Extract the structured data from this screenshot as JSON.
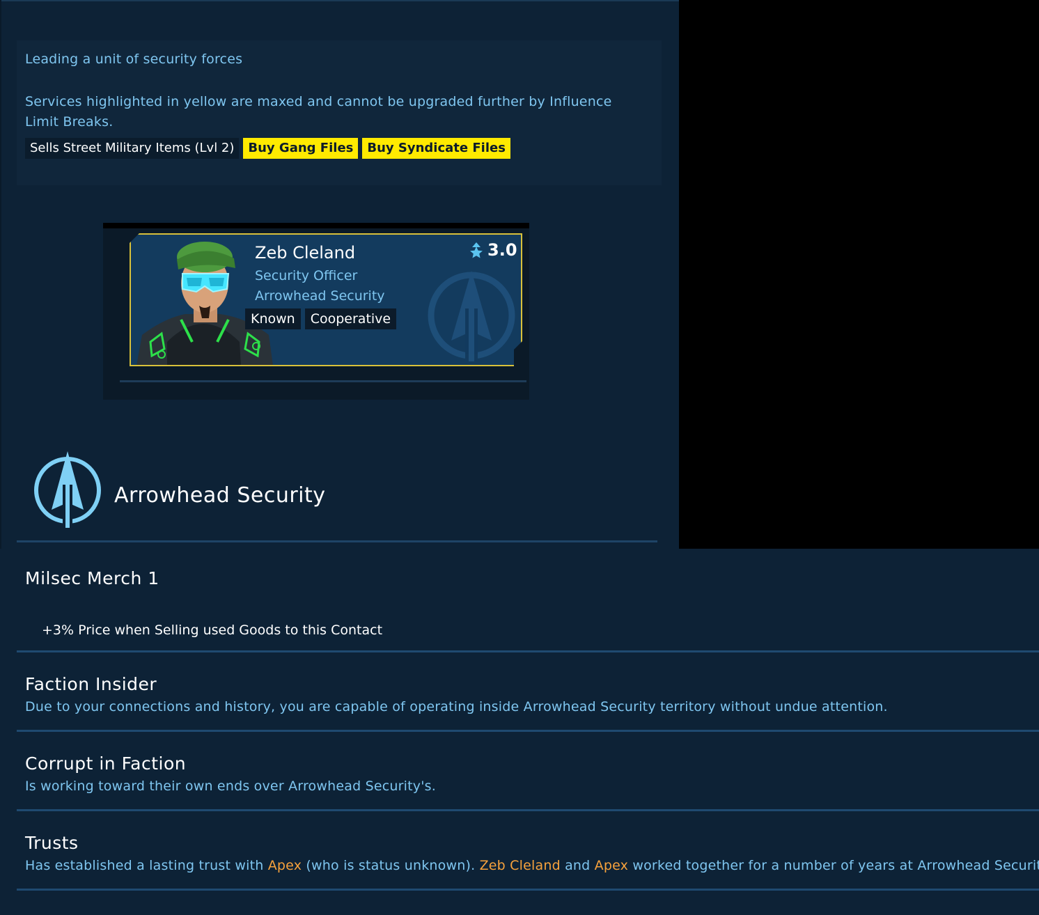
{
  "contact": {
    "description": "Leading a unit of security forces",
    "services_note": "Services highlighted in yellow are maxed and cannot be upgraded further by Influence Limit Breaks.",
    "services": [
      {
        "label": "Sells Street Military Items (Lvl 2)",
        "maxed": false
      },
      {
        "label": "Buy Gang Files",
        "maxed": true
      },
      {
        "label": "Buy Syndicate Files",
        "maxed": true
      }
    ],
    "name": "Zeb Cleland",
    "role": "Security Officer",
    "faction": "Arrowhead Security",
    "rating": "3.0",
    "tags": [
      "Known",
      "Cooperative"
    ]
  },
  "faction_header": {
    "title": "Arrowhead Security",
    "icon": "arrowhead-logo-icon"
  },
  "colors": {
    "maxed_service": "#ffea00",
    "highlight_name": "#f7a23c",
    "text_blue": "#7fc6f0",
    "card_border": "#d9c13a"
  },
  "traits": [
    {
      "title": "Milsec Merch 1",
      "bonus": "+3% Price when Selling used Goods to this Contact"
    },
    {
      "title": "Faction Insider",
      "text": "Due to your connections and history, you are capable of operating inside Arrowhead Security territory without undue attention."
    },
    {
      "title": "Corrupt in Faction",
      "text": "Is working toward their own ends over Arrowhead Security's."
    },
    {
      "title": "Trusts",
      "text_parts": [
        {
          "t": "Has established a lasting trust with ",
          "hl": false
        },
        {
          "t": "Apex",
          "hl": true
        },
        {
          "t": " (who is status unknown). ",
          "hl": false
        },
        {
          "t": "Zeb Cleland",
          "hl": true
        },
        {
          "t": " and ",
          "hl": false
        },
        {
          "t": "Apex",
          "hl": true
        },
        {
          "t": " worked together for a number of years at Arrowhead Security.",
          "hl": false
        }
      ]
    }
  ]
}
